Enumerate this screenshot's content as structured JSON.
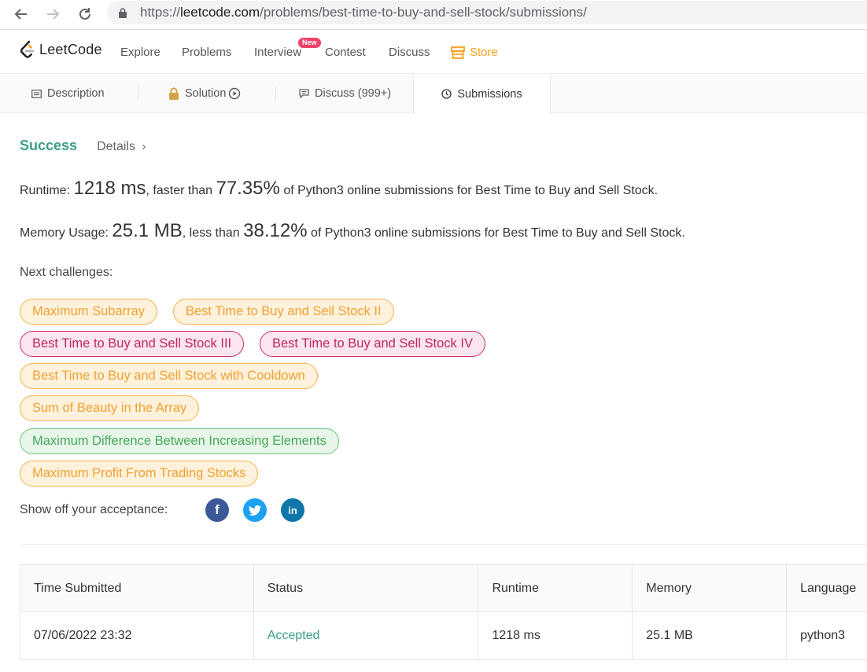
{
  "browser": {
    "url_prefix": "https://",
    "url_host": "leetcode.com",
    "url_path": "/problems/best-time-to-buy-and-sell-stock/submissions/"
  },
  "header": {
    "logo": "LeetCode",
    "nav": [
      "Explore",
      "Problems",
      "Interview",
      "Contest",
      "Discuss"
    ],
    "new_badge": "New",
    "store": "Store"
  },
  "tabs": {
    "description": "Description",
    "solution": "Solution",
    "discuss": "Discuss (999+)",
    "submissions": "Submissions"
  },
  "result": {
    "status": "Success",
    "details": "Details",
    "runtime_label": "Runtime: ",
    "runtime_value": "1218 ms",
    "runtime_mid": ", faster than ",
    "runtime_pct": "77.35%",
    "runtime_tail": " of Python3 online submissions for Best Time to Buy and Sell Stock.",
    "memory_label": "Memory Usage: ",
    "memory_value": "25.1 MB",
    "memory_mid": ", less than ",
    "memory_pct": "38.12%",
    "memory_tail": " of Python3 online submissions for Best Time to Buy and Sell Stock."
  },
  "next_challenges": {
    "label": "Next challenges:",
    "items": [
      {
        "title": "Maximum Subarray",
        "difficulty": "medium"
      },
      {
        "title": "Best Time to Buy and Sell Stock II",
        "difficulty": "medium"
      },
      {
        "title": "Best Time to Buy and Sell Stock III",
        "difficulty": "hard"
      },
      {
        "title": "Best Time to Buy and Sell Stock IV",
        "difficulty": "hard"
      },
      {
        "title": "Best Time to Buy and Sell Stock with Cooldown",
        "difficulty": "medium"
      },
      {
        "title": "Sum of Beauty in the Array",
        "difficulty": "medium"
      },
      {
        "title": "Maximum Difference Between Increasing Elements",
        "difficulty": "easy"
      },
      {
        "title": "Maximum Profit From Trading Stocks",
        "difficulty": "medium"
      }
    ]
  },
  "share": {
    "label": "Show off your acceptance:",
    "facebook": "f",
    "linkedin": "in"
  },
  "submissions_table": {
    "columns": [
      "Time Submitted",
      "Status",
      "Runtime",
      "Memory",
      "Language"
    ],
    "rows": [
      [
        "07/06/2022 23:32",
        "Accepted",
        "1218 ms",
        "25.1 MB",
        "python3"
      ]
    ]
  },
  "colors": {
    "success": "#3a9f8a",
    "medium": "#f0a032",
    "hard": "#c1245f",
    "easy": "#46a85a",
    "facebook": "#3b5998",
    "twitter": "#1da1f2",
    "linkedin": "#0e76a8"
  }
}
